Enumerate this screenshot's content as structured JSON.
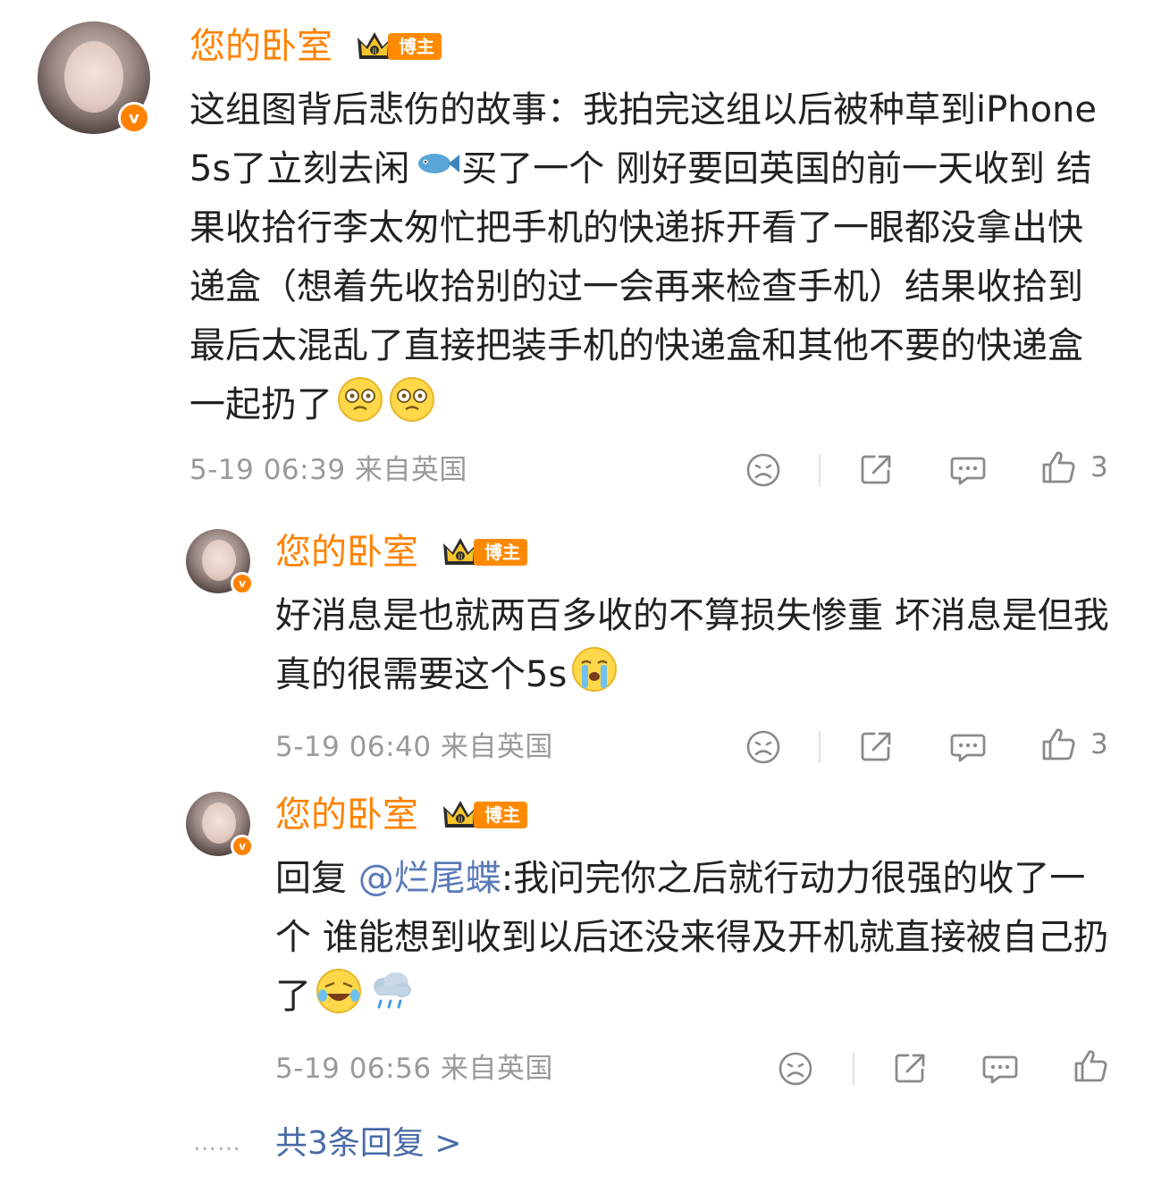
{
  "comment": {
    "username": "您的卧室",
    "badge_label": "博主",
    "text": "这组图背后悲伤的故事：我拍完这组以后被种草到iPhone5s了立刻去闲",
    "text_after_fish": "买了一个 刚好要回英国的前一天收到 结果收拾行李太匆忙把手机的快递拆开看了一眼都没拿出快递盒（想着先收拾别的过一会再来检查手机）结果收拾到最后太混乱了直接把装手机的快递盒和其他不要的快递盒一起扔了",
    "time": "5-19 06:39",
    "location": "来自英国",
    "like_count": "3"
  },
  "replies": [
    {
      "username": "您的卧室",
      "badge_label": "博主",
      "text": "好消息是也就两百多收的不算损失惨重 坏消息是但我真的很需要这个5s",
      "time": "5-19 06:40",
      "location": "来自英国",
      "like_count": "3"
    },
    {
      "username": "您的卧室",
      "badge_label": "博主",
      "reply_prefix": "回复 ",
      "mention": "@烂尾蝶",
      "text": ":我问完你之后就行动力很强的收了一个 谁能想到收到以后还没来得及开机就直接被自己扔了",
      "time": "5-19 06:56",
      "location": "来自英国"
    }
  ],
  "dots": "……",
  "more_replies": "共3条回复 >",
  "icons": {
    "dislike": "sad-face-icon",
    "share": "share-icon",
    "comment": "comment-icon",
    "like": "thumbs-up-icon",
    "verified": "verified-v-icon",
    "crown": "crown-icon"
  },
  "colors": {
    "username": "#ff8200",
    "mention": "#5b7ab8",
    "meta": "#9a9a9a",
    "more": "#4a6ba6"
  }
}
